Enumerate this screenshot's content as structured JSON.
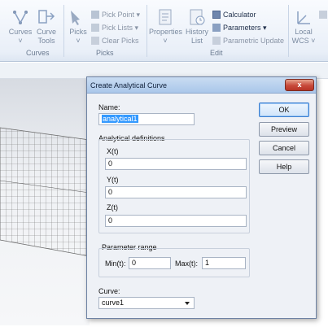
{
  "ribbon": {
    "curves_btn": "Curves",
    "curve_tools_btn_l1": "Curve",
    "curve_tools_btn_l2": "Tools",
    "curves_group": "Curves",
    "picks_btn": "Picks",
    "pick_point": "Pick Point",
    "pick_lists": "Pick Lists",
    "clear_picks": "Clear Picks",
    "picks_group": "Picks",
    "properties_btn": "Properties",
    "history_btn_l1": "History",
    "history_btn_l2": "List",
    "calculator": "Calculator",
    "parameters": "Parameters",
    "parametric_update": "Parametric Update",
    "edit_group": "Edit",
    "local_wcs_l1": "Local",
    "local_wcs_l2": "WCS"
  },
  "dialog": {
    "title": "Create Analytical Curve",
    "close_glyph": "x",
    "name_label": "Name:",
    "name_value": "analytical1",
    "analytical_header": "Analytical definitions",
    "xt_label": "X(t)",
    "xt_value": "0",
    "yt_label": "Y(t)",
    "yt_value": "0",
    "zt_label": "Z(t)",
    "zt_value": "0",
    "param_header": "Parameter range",
    "min_label": "Min(t):",
    "min_value": "0",
    "max_label": "Max(t):",
    "max_value": "1",
    "curve_label": "Curve:",
    "curve_value": "curve1",
    "ok": "OK",
    "preview": "Preview",
    "cancel": "Cancel",
    "help": "Help"
  }
}
